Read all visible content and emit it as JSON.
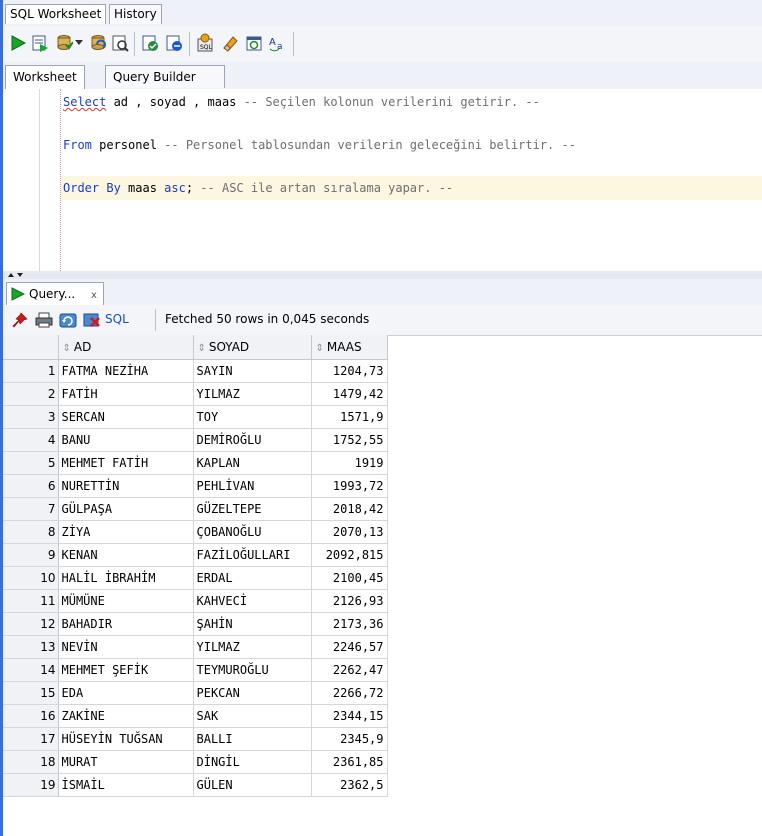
{
  "top_tabs": [
    {
      "label": "SQL Worksheet"
    },
    {
      "label": "History"
    }
  ],
  "worksheet_tabs": [
    {
      "label": "Worksheet"
    },
    {
      "label": "Query Builder"
    }
  ],
  "editor": {
    "lines": [
      {
        "kw": "Select",
        "rest": " ad , soyad , maas ",
        "comment": "-- Seçilen kolonun verilerini getirir. --"
      },
      {
        "kw": "From",
        "rest": " personel ",
        "comment": "-- Personel tablosundan verilerin geleceğini belirtir. --"
      },
      {
        "kw": "Order By",
        "rest": " maas ",
        "kw2": "asc",
        "rest2": "; ",
        "comment": "-- ASC ile artan sıralama yapar. --"
      }
    ]
  },
  "result": {
    "tab_label": "Query...",
    "tab_close": "x",
    "sql_label": "SQL",
    "status": "Fetched 50 rows in 0,045 seconds",
    "columns": [
      "AD",
      "SOYAD",
      "MAAS"
    ],
    "rows": [
      [
        "1",
        "FATMA NEZİHA",
        "SAYIN",
        "1204,73"
      ],
      [
        "2",
        "FATİH",
        "YILMAZ",
        "1479,42"
      ],
      [
        "3",
        "SERCAN",
        "TOY",
        "1571,9"
      ],
      [
        "4",
        "BANU",
        "DEMİROĞLU",
        "1752,55"
      ],
      [
        "5",
        "MEHMET FATİH",
        "KAPLAN",
        "1919"
      ],
      [
        "6",
        "NURETTİN",
        "PEHLİVAN",
        "1993,72"
      ],
      [
        "7",
        "GÜLPAŞA",
        "GÜZELTEPE",
        "2018,42"
      ],
      [
        "8",
        "ZİYA",
        "ÇOBANOĞLU",
        "2070,13"
      ],
      [
        "9",
        "KENAN",
        "FAZİLOĞULLARI",
        "2092,815"
      ],
      [
        "10",
        "HALİL İBRAHİM",
        "ERDAL",
        "2100,45"
      ],
      [
        "11",
        "MÜMÜNE",
        "KAHVECİ",
        "2126,93"
      ],
      [
        "12",
        "BAHADIR",
        "ŞAHİN",
        "2173,36"
      ],
      [
        "13",
        "NEVİN",
        "YILMAZ",
        "2246,57"
      ],
      [
        "14",
        "MEHMET ŞEFİK",
        "TEYMUROĞLU",
        "2262,47"
      ],
      [
        "15",
        "EDA",
        "PEKCAN",
        "2266,72"
      ],
      [
        "16",
        "ZAKİNE",
        "SAK",
        "2344,15"
      ],
      [
        "17",
        "HÜSEYİN TUĞSAN",
        "BALLI",
        "2345,9"
      ],
      [
        "18",
        "MURAT",
        "DİNGİL",
        "2361,85"
      ],
      [
        "19",
        "İSMAİL",
        "GÜLEN",
        "2362,5"
      ]
    ]
  },
  "toolbar_icons": [
    "run-statement-icon",
    "run-script-icon",
    "commit-icon",
    "dropdown-arrow-icon",
    "rollback-icon",
    "autotrace-icon",
    "explain-plan-icon",
    "sql-tuning-icon",
    "unshared-sql-icon",
    "eraser-icon",
    "history-icon",
    "format-case-icon"
  ],
  "result_icons": [
    "pin-icon",
    "print-icon",
    "refresh-icon",
    "delete-icon"
  ],
  "colors": {
    "keyword": "#1a3dc7",
    "comment": "#6e6e6e",
    "accent": "#3b6cdb"
  }
}
